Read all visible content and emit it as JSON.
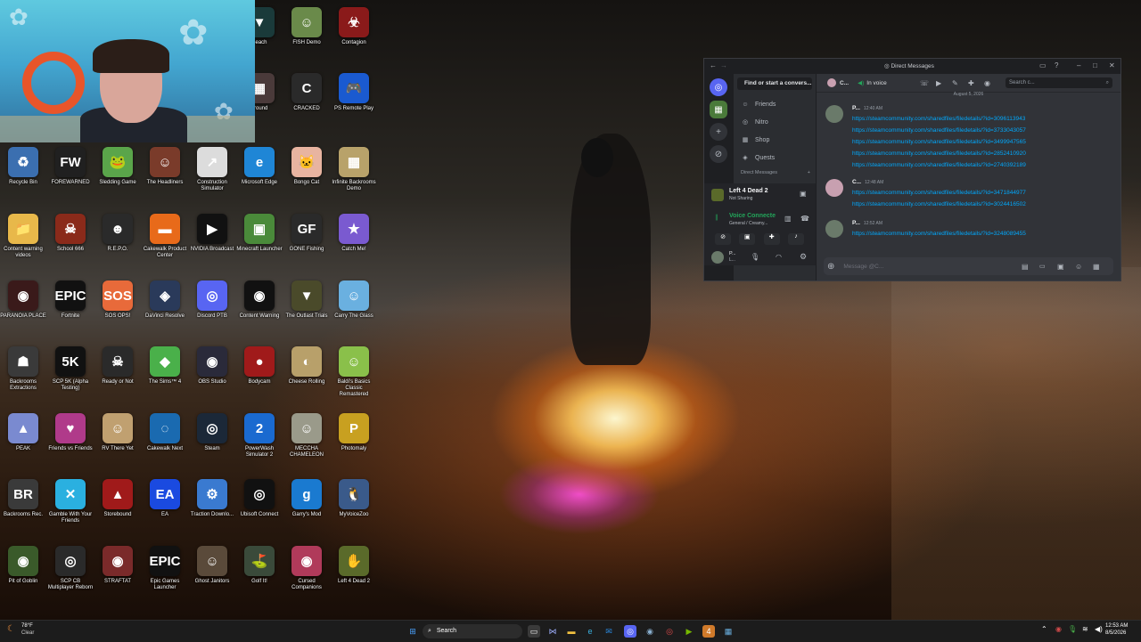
{
  "webcam": {
    "label": "webcam overlay"
  },
  "desktop_icons": [
    {
      "label": "Recycle Bin",
      "glyph": "♻",
      "bg": "#3b6fb0"
    },
    {
      "label": "FOREWARNED",
      "glyph": "FW",
      "bg": "#202020"
    },
    {
      "label": "Sledding Game",
      "glyph": "🐸",
      "bg": "#5aa54a"
    },
    {
      "label": "The Headliners",
      "glyph": "☺",
      "bg": "#7a3b2a"
    },
    {
      "label": "Construction Simulator",
      "glyph": "↗",
      "bg": "#dcdcdc"
    },
    {
      "label": "Microsoft Edge",
      "glyph": "e",
      "bg": "#1f86d6"
    },
    {
      "label": "Bongo Cat",
      "glyph": "🐱",
      "bg": "#e8b4a0"
    },
    {
      "label": "Infinite Backrooms Demo",
      "glyph": "▦",
      "bg": "#b8a26a"
    },
    {
      "label": "Content warning videos",
      "glyph": "📁",
      "bg": "#e8b84a"
    },
    {
      "label": "School 666",
      "glyph": "☠",
      "bg": "#8a2a1a"
    },
    {
      "label": "R.E.P.O.",
      "glyph": "☻",
      "bg": "#2a2a2a"
    },
    {
      "label": "Cakewalk Product Center",
      "glyph": "▬",
      "bg": "#e86a1a"
    },
    {
      "label": "NVIDIA Broadcast",
      "glyph": "▶",
      "bg": "#111"
    },
    {
      "label": "Minecraft Launcher",
      "glyph": "▣",
      "bg": "#4a8a3a"
    },
    {
      "label": "GONE Fishing",
      "glyph": "GF",
      "bg": "#2a2a2a"
    },
    {
      "label": "Catch Me!",
      "glyph": "★",
      "bg": "#7a5ad0"
    },
    {
      "label": "PARANOIA PLACE",
      "glyph": "◉",
      "bg": "#3a1a1a"
    },
    {
      "label": "Fortnite",
      "glyph": "EPIC",
      "bg": "#111"
    },
    {
      "label": "SOS OPS!",
      "glyph": "SOS",
      "bg": "#e86a3a"
    },
    {
      "label": "DaVinci Resolve",
      "glyph": "◈",
      "bg": "#2a3a5a"
    },
    {
      "label": "Discord PTB",
      "glyph": "◎",
      "bg": "#5865f2"
    },
    {
      "label": "Content Warning",
      "glyph": "◉",
      "bg": "#111"
    },
    {
      "label": "The Outlast Trials",
      "glyph": "▼",
      "bg": "#4a4a2a"
    },
    {
      "label": "Carry The Glass",
      "glyph": "☺",
      "bg": "#6ab0e0"
    },
    {
      "label": "Backrooms Extractions",
      "glyph": "☗",
      "bg": "#3a3a3a"
    },
    {
      "label": "SCP 5K (Alpha Testing)",
      "glyph": "5K",
      "bg": "#111"
    },
    {
      "label": "Ready or Not",
      "glyph": "☠",
      "bg": "#2a2a2a"
    },
    {
      "label": "The Sims™ 4",
      "glyph": "◆",
      "bg": "#4ab04a"
    },
    {
      "label": "OBS Studio",
      "glyph": "◉",
      "bg": "#2a2a3a"
    },
    {
      "label": "Bodycam",
      "glyph": "●",
      "bg": "#a01a1a"
    },
    {
      "label": "Cheese Rolling",
      "glyph": "◐",
      "bg": "#b8a06a"
    },
    {
      "label": "Baldi's Basics Classic Remastered",
      "glyph": "☺",
      "bg": "#8ac04a"
    },
    {
      "label": "PEAK",
      "glyph": "▲",
      "bg": "#7a8ad0"
    },
    {
      "label": "Friends vs Friends",
      "glyph": "♥",
      "bg": "#b03a8a"
    },
    {
      "label": "RV There Yet",
      "glyph": "☺",
      "bg": "#c0a070"
    },
    {
      "label": "Cakewalk Next",
      "glyph": "◌",
      "bg": "#1a6ab0"
    },
    {
      "label": "Steam",
      "glyph": "◎",
      "bg": "#1b2838"
    },
    {
      "label": "PowerWash Simulator 2",
      "glyph": "2",
      "bg": "#1a6ad0"
    },
    {
      "label": "MECCHA CHAMELEON",
      "glyph": "☺",
      "bg": "#9a9a8a"
    },
    {
      "label": "Photomaly",
      "glyph": "P",
      "bg": "#c8a020"
    },
    {
      "label": "Backrooms Rec.",
      "glyph": "BR",
      "bg": "#3a3a3a"
    },
    {
      "label": "Gamble With Your Friends",
      "glyph": "✕",
      "bg": "#2ab0e0"
    },
    {
      "label": "Storebound",
      "glyph": "▲",
      "bg": "#a01a1a"
    },
    {
      "label": "EA",
      "glyph": "EA",
      "bg": "#1a4ae0"
    },
    {
      "label": "Traction Downlo...",
      "glyph": "⚙",
      "bg": "#3a7ad0"
    },
    {
      "label": "Ubisoft Connect",
      "glyph": "◎",
      "bg": "#111"
    },
    {
      "label": "Garry's Mod",
      "glyph": "g",
      "bg": "#1a7ad0"
    },
    {
      "label": "MyVoiceZoo",
      "glyph": "🐧",
      "bg": "#3a5a8a"
    },
    {
      "label": "Pit of Goblin",
      "glyph": "◉",
      "bg": "#3a5a2a"
    },
    {
      "label": "SCP CB Multiplayer Reborn",
      "glyph": "◎",
      "bg": "#2a2a2a"
    },
    {
      "label": "STRAFTAT",
      "glyph": "◉",
      "bg": "#7a2a2a"
    },
    {
      "label": "Epic Games Launcher",
      "glyph": "EPIC",
      "bg": "#111"
    },
    {
      "label": "Ghost Janitors",
      "glyph": "☺",
      "bg": "#5a4a3a"
    },
    {
      "label": "Golf It!",
      "glyph": "⛳",
      "bg": "#3a4a3a"
    },
    {
      "label": "Cursed Companions",
      "glyph": "◉",
      "bg": "#b03a5a"
    },
    {
      "label": "Left 4 Dead 2",
      "glyph": "✋",
      "bg": "#5a6a2a"
    }
  ],
  "top_partial_icons": [
    {
      "label": "Beach",
      "glyph": "▼",
      "bg": "#1a3a3a"
    },
    {
      "label": "FISH Demo",
      "glyph": "☺",
      "bg": "#6a8a4a"
    },
    {
      "label": "Contagion",
      "glyph": "☣",
      "bg": "#8a1a1a"
    },
    {
      "label": "ground",
      "glyph": "▦",
      "bg": "#4a3a3a"
    },
    {
      "label": "CRACKED",
      "glyph": "C",
      "bg": "#2a2a2a"
    },
    {
      "label": "PS Remote Play",
      "glyph": "🎮",
      "bg": "#1a5ad0"
    }
  ],
  "discord": {
    "title": "Direct Messages",
    "search_dm": "Find or start a convers...",
    "nav": [
      {
        "label": "Friends",
        "icon": "☺"
      },
      {
        "label": "Nitro",
        "icon": "◎"
      },
      {
        "label": "Shop",
        "icon": "▦"
      },
      {
        "label": "Quests",
        "icon": "◈"
      }
    ],
    "dm_header": "Direct Messages",
    "game": {
      "title": "Left 4 Dead 2",
      "status": "Not Sharing"
    },
    "voice": {
      "title": "Voice Connecte",
      "channel": "General / Creamy..."
    },
    "user": {
      "name": "P...",
      "sub": "L..."
    },
    "header_user": "C...",
    "in_voice": "In voice",
    "search_placeholder": "Search c...",
    "date_divider": "August 5, 2026",
    "messages": [
      {
        "name": "P...",
        "time": "12:40 AM",
        "avatar": "#6a7a6a",
        "links": [
          "https://steamcommunity.com/sharedfiles/filedetails/?id=3096113943",
          "https://steamcommunity.com/sharedfiles/filedetails/?id=3733043057",
          "https://steamcommunity.com/sharedfiles/filedetails/?id=3499947565",
          "https://steamcommunity.com/sharedfiles/filedetails/?id=2852410920",
          "https://steamcommunity.com/sharedfiles/filedetails/?id=2740392189"
        ]
      },
      {
        "name": "C...",
        "time": "12:48 AM",
        "avatar": "#c8a0b0",
        "links": [
          "https://steamcommunity.com/sharedfiles/filedetails/?id=3471844977",
          "https://steamcommunity.com/sharedfiles/filedetails/?id=3024416502"
        ]
      },
      {
        "name": "P...",
        "time": "12:52 AM",
        "avatar": "#6a7a6a",
        "links": [
          "https://steamcommunity.com/sharedfiles/filedetails/?id=3248089455"
        ]
      }
    ],
    "composer_placeholder": "Message @C..."
  },
  "taskbar": {
    "weather_temp": "78°F",
    "weather_text": "Clear",
    "search_label": "Search",
    "time": "12:53 AM",
    "date": "8/5/2026"
  }
}
